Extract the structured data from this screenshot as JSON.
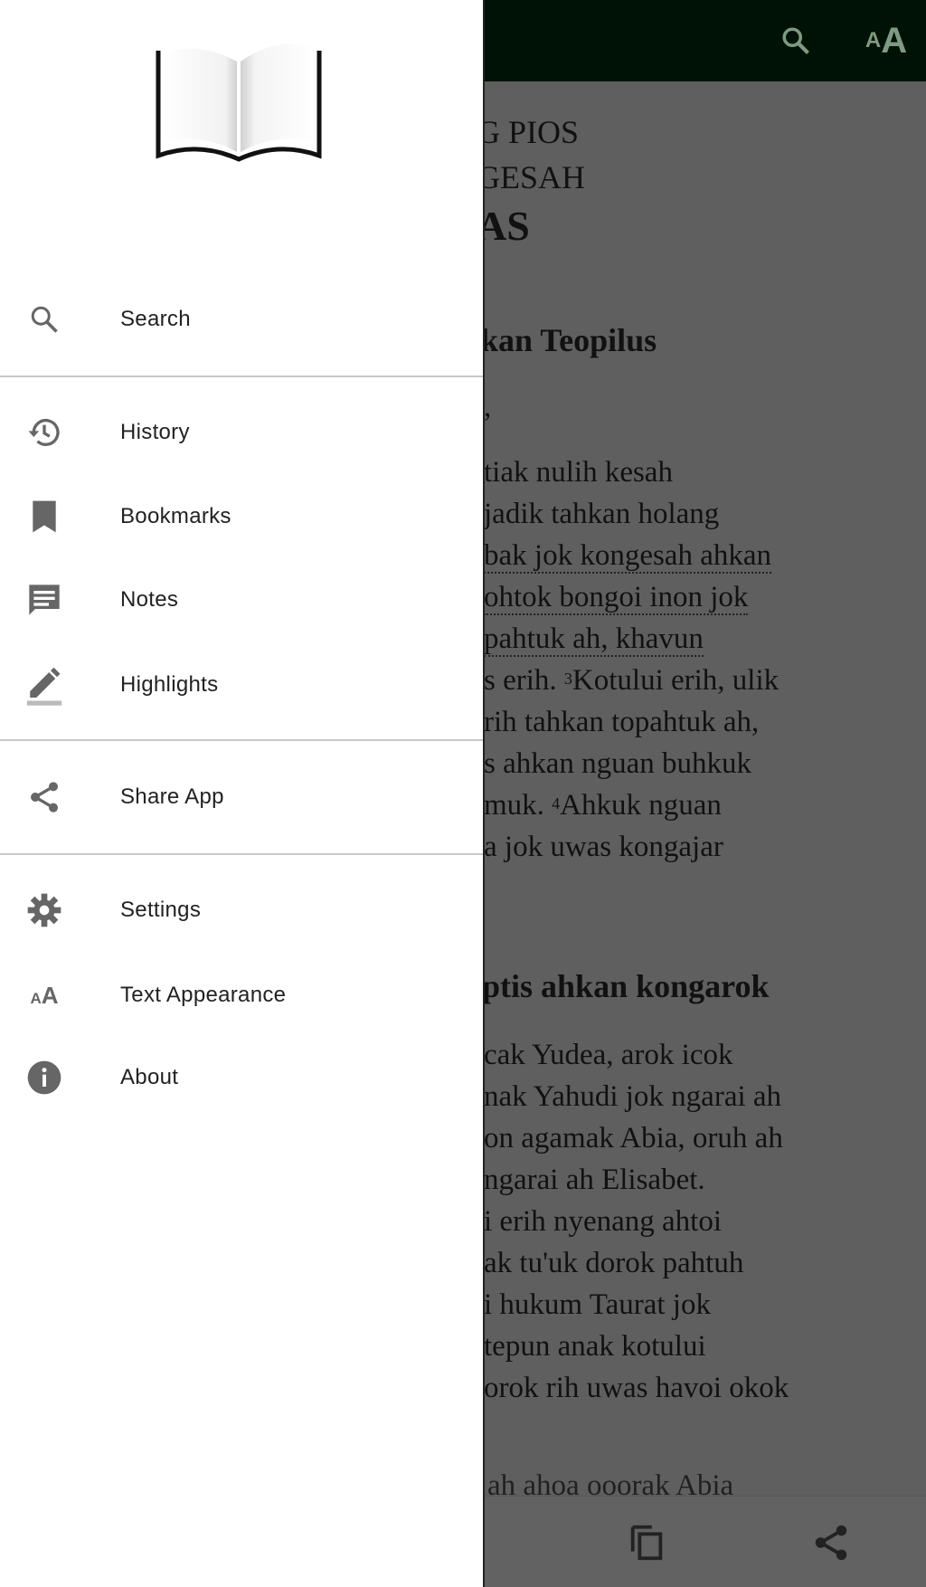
{
  "topbar": {
    "icons": [
      "search-icon",
      "text-size-icon"
    ],
    "color": "#001205"
  },
  "content": {
    "title_lines": [
      "G PIOS",
      "GESAH"
    ],
    "title_big": "AS",
    "heading1": "kan Teopilus",
    "comma": ",",
    "para1": [
      {
        "text": "tiak nulih kesah",
        "dotted": false
      },
      {
        "text": "jadik tahkan holang",
        "dotted": false
      },
      {
        "text": "bak jok kongesah ahkan",
        "dotted": true
      },
      {
        "text": "ohtok bongoi inon jok",
        "dotted": true
      },
      {
        "text": "pahtuk ah, khavun",
        "dotted": true
      },
      {
        "text": "s erih. ",
        "dotted": false,
        "verse": "3",
        "rest": "Kotului erih, ulik"
      },
      {
        "text": "rih tahkan topahtuk ah,",
        "dotted": false
      },
      {
        "text": "s ahkan nguan buhkuk",
        "dotted": false
      },
      {
        "text": "muk. ",
        "dotted": false,
        "verse": "4",
        "rest": "Ahkuk nguan"
      },
      {
        "text": "a jok uwas kongajar",
        "dotted": false
      }
    ],
    "heading2": "ptis ahkan kongarok",
    "para2": [
      "cak Yudea, arok icok",
      "nak Yahudi jok ngarai ah",
      "on agamak Abia, oruh ah",
      "ngarai ah Elisabet.",
      "i erih nyenang ahtoi",
      "ak tu'uk dorok pahtuh",
      "i hukum Taurat jok",
      "tepun anak kotului",
      "orok rih uwas havoi okok"
    ],
    "partial": "ah ahoa ooorak Abia"
  },
  "bottombar": {
    "icons": [
      "copy-icon",
      "share-icon"
    ]
  },
  "drawer": {
    "logo": "open-book-logo",
    "items": [
      {
        "label": "Search",
        "icon": "search-icon"
      },
      {
        "label": "History",
        "icon": "history-icon"
      },
      {
        "label": "Bookmarks",
        "icon": "bookmark-icon"
      },
      {
        "label": "Notes",
        "icon": "notes-icon"
      },
      {
        "label": "Highlights",
        "icon": "highlight-pen-icon"
      },
      {
        "label": "Share App",
        "icon": "share-icon"
      },
      {
        "label": "Settings",
        "icon": "gear-icon"
      },
      {
        "label": "Text Appearance",
        "icon": "text-size-icon"
      },
      {
        "label": "About",
        "icon": "info-icon"
      }
    ]
  }
}
